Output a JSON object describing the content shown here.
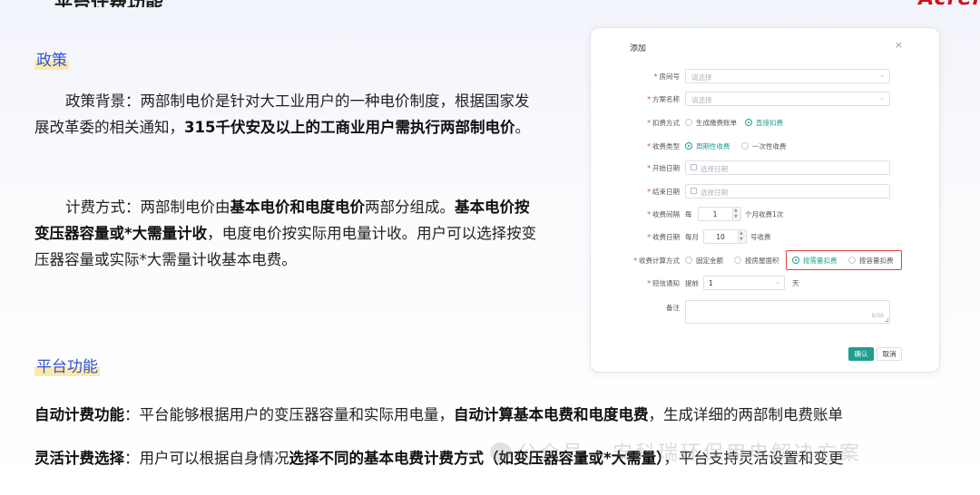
{
  "header": {
    "title_fragment": "平台计费功能",
    "logo": "Acrel"
  },
  "policy": {
    "tag": "政策",
    "background": {
      "lead": "政策背景：两部制电价是针对大工业用户的一种电价制度，根据国家发展改革委的相关通知，",
      "bold": "315千伏安及以上的工商业用户需执行两部制电价",
      "end": "。"
    },
    "method": {
      "p1": "计费方式：两部制电价由",
      "b1": "基本电价和电度电价",
      "p2": "两部分组成。",
      "b2": "基本电价按变压器容量或*大需量计收",
      "p3": "，电度电价按实际用电量计收。用户可以选择按变压器容量或实际*大需量计收基本电费。"
    }
  },
  "platform": {
    "tag": "平台功能",
    "auto": {
      "label": "自动计费功能",
      "p1": "：平台能够根据用户的变压器容量和实际用电量，",
      "b1": "自动计算基本电费和电度电费",
      "p2": "，生成详细的两部制电费账单"
    },
    "flex": {
      "label": "灵活计费选择",
      "p1": "：用户可以根据自身情况",
      "b1": "选择不同的基本电费计费方式（如变压器容量或*大需量）",
      "p2": "，平台支持灵活设置和变更"
    }
  },
  "dialog": {
    "title": "添加",
    "close": "×",
    "room": {
      "label": "房间号",
      "placeholder": "请选择"
    },
    "plan": {
      "label": "方案名称",
      "placeholder": "请选择"
    },
    "deduct": {
      "label": "扣费方式",
      "opt1": "生成缴费账单",
      "opt2": "直接扣费"
    },
    "charge_type": {
      "label": "收费类型",
      "opt1": "周期性收费",
      "opt2": "一次性收费"
    },
    "start_date": {
      "label": "开始日期",
      "placeholder": "选择日期"
    },
    "end_date": {
      "label": "结束日期",
      "placeholder": "选择日期"
    },
    "interval": {
      "label": "收费间隔",
      "prefix": "每",
      "value": "1",
      "suffix": "个月收费1次"
    },
    "charge_day": {
      "label": "收费日期",
      "prefix": "每月",
      "value": "10",
      "suffix": "号收费"
    },
    "calc": {
      "label": "收费计算方式",
      "opt1": "固定金额",
      "opt2": "按房屋面积",
      "opt3": "按需量扣费",
      "opt4": "按容量扣费"
    },
    "sms": {
      "label": "短信通知",
      "prefix": "提前",
      "value": "1",
      "suffix": "天"
    },
    "remark": {
      "label": "备注",
      "counter": "0/50"
    },
    "ok": "确认",
    "cancel": "取消"
  },
  "watermark": "公众号 · 安科瑞环保用电解决方案"
}
